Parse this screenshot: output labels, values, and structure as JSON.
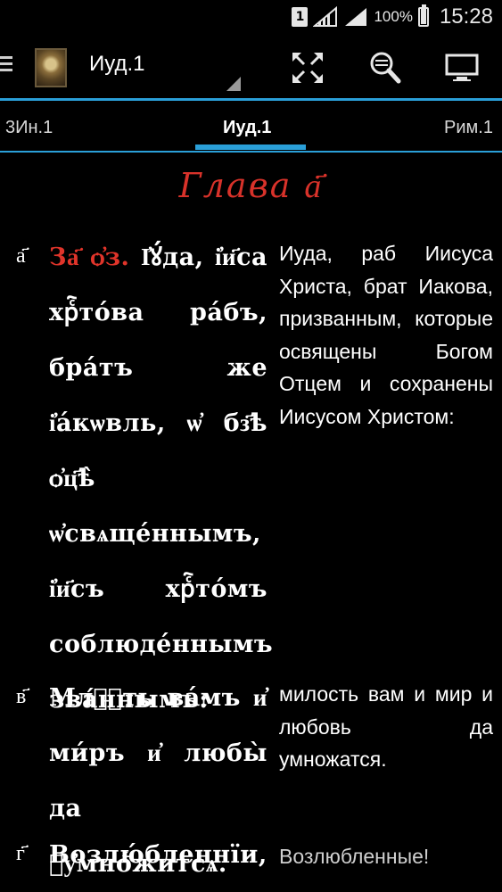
{
  "status_bar": {
    "sim_slot": "1",
    "battery_percent": "100%",
    "battery_level": 1.0,
    "time": "15:28"
  },
  "action_bar": {
    "title": "Иуд.1",
    "icons": [
      "menu-icon",
      "book-icon",
      "fullscreen-icon",
      "search-icon",
      "monitor-icon"
    ]
  },
  "tabs": {
    "prev": "3Ин.1",
    "current": "Иуд.1",
    "next": "Рим.1"
  },
  "chapter_title": "Глава а҃",
  "verses": [
    {
      "num": "а҃",
      "ref": "За҃ ѻ҆з.",
      "slavonic": "І҆ꙋ́да, і҆и҃са хрⷭ҇то́ва ра́бъ, бра́тъ же і҆а́кѡвль, ѡ҆ бз҃ѣ ѻ҆ц҃ѣ̀ ѡ҆свѧще́ннымъ, і҆и҃съ хрⷭ҇то́мъ соблюде́ннымъ зва́ннымъ:",
      "russian": "Иуда, раб Иисуса Христа, брат Иакова, призванным, которые освящены Богом Отцем и сохранены Иисусом Христом:"
    },
    {
      "num": "в҃",
      "ref": "",
      "slavonic": "Млⷭ҇ть ва́мъ и҆ ми́ръ и҆ любы̀ да ᲂу҆мно́житсѧ.",
      "russian": "милость вам и мир и любовь да умножатся."
    },
    {
      "num": "г҃",
      "ref": "",
      "slavonic": "Возлю́бленнїи,",
      "russian": "Возлюбленные!"
    }
  ],
  "colors": {
    "accent": "#2a9fd8",
    "chapter_red": "#d8322a",
    "background": "#000000"
  }
}
